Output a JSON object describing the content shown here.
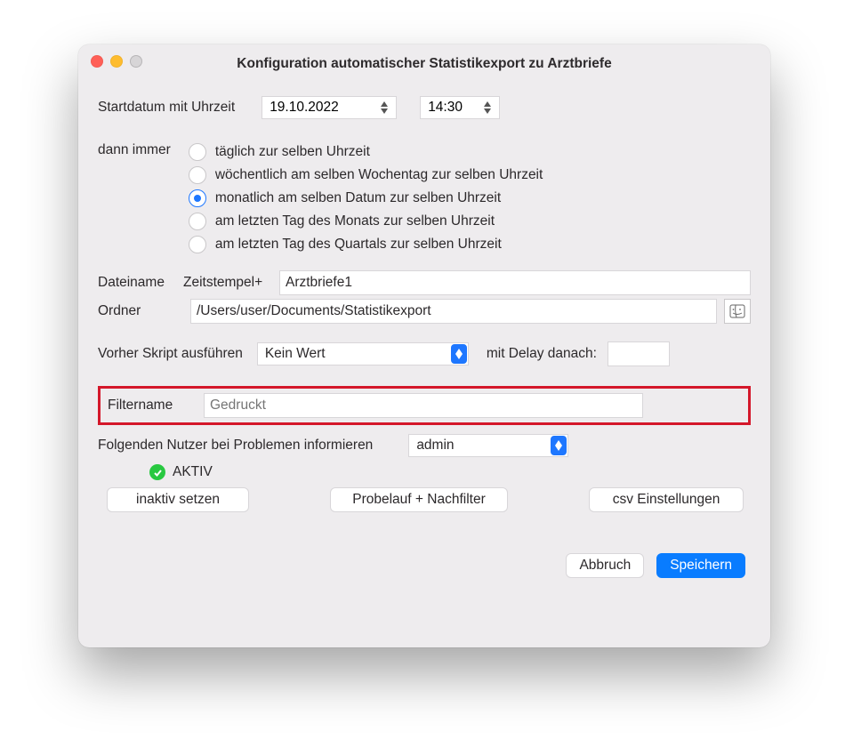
{
  "window": {
    "title": "Konfiguration automatischer Statistikexport zu Arztbriefe"
  },
  "start": {
    "label": "Startdatum mit Uhrzeit",
    "date": "19.10.2022",
    "time": "14:30"
  },
  "recurrence": {
    "label": "dann immer",
    "options": [
      "täglich zur selben Uhrzeit",
      "wöchentlich am selben Wochentag zur selben Uhrzeit",
      "monatlich am selben Datum zur selben Uhrzeit",
      "am letzten Tag des Monats zur selben Uhrzeit",
      "am letzten Tag des Quartals zur selben Uhrzeit"
    ],
    "selected_index": 2
  },
  "file": {
    "dateiname_label": "Dateiname",
    "zeitstempel_label": "Zeitstempel+",
    "filename": "Arztbriefe1",
    "ordner_label": "Ordner",
    "folder": "/Users/user/Documents/Statistikexport"
  },
  "script": {
    "label": "Vorher Skript ausführen",
    "value": "Kein Wert",
    "delay_label": "mit Delay danach:",
    "delay_value": ""
  },
  "filter": {
    "label": "Filtername",
    "placeholder": "Gedruckt",
    "value": ""
  },
  "notify": {
    "label": "Folgenden Nutzer bei Problemen informieren",
    "user": "admin"
  },
  "status": {
    "text": "AKTIV"
  },
  "buttons": {
    "inaktiv": "inaktiv setzen",
    "probelauf": "Probelauf + Nachfilter",
    "csv": "csv Einstellungen",
    "cancel": "Abbruch",
    "save": "Speichern"
  }
}
